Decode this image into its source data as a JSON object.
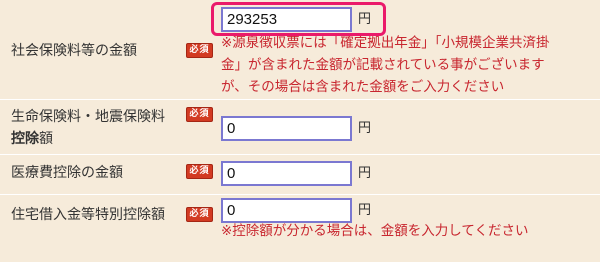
{
  "rows": [
    {
      "label": "社会保険料等の金額",
      "required": "必須",
      "value": "293253",
      "unit": "円",
      "notes": [
        "※源泉徴収票には「確定拠出年金」「小規模企業共済掛",
        "金」が含まれた金額が記載されている事がございます",
        "が、その場合は含まれた金額をご入力ください"
      ]
    },
    {
      "label_line1": "生命保険料・地震保険料",
      "label_line2_bold": "控除",
      "label_line2_rest": "額",
      "required": "必須",
      "value": "0",
      "unit": "円"
    },
    {
      "label": "医療費控除の金額",
      "required": "必須",
      "value": "0",
      "unit": "円"
    },
    {
      "label": "住宅借入金等特別控除額",
      "required": "必須",
      "value": "0",
      "unit": "円",
      "notes": [
        "※控除額が分かる場合は、金額を入力してください"
      ]
    }
  ],
  "colors": {
    "background": "#f6ebda",
    "input_border": "#7b78d1",
    "required_badge": "#d23a22",
    "note_text": "#c8262f",
    "highlight": "#ea1a6a"
  }
}
